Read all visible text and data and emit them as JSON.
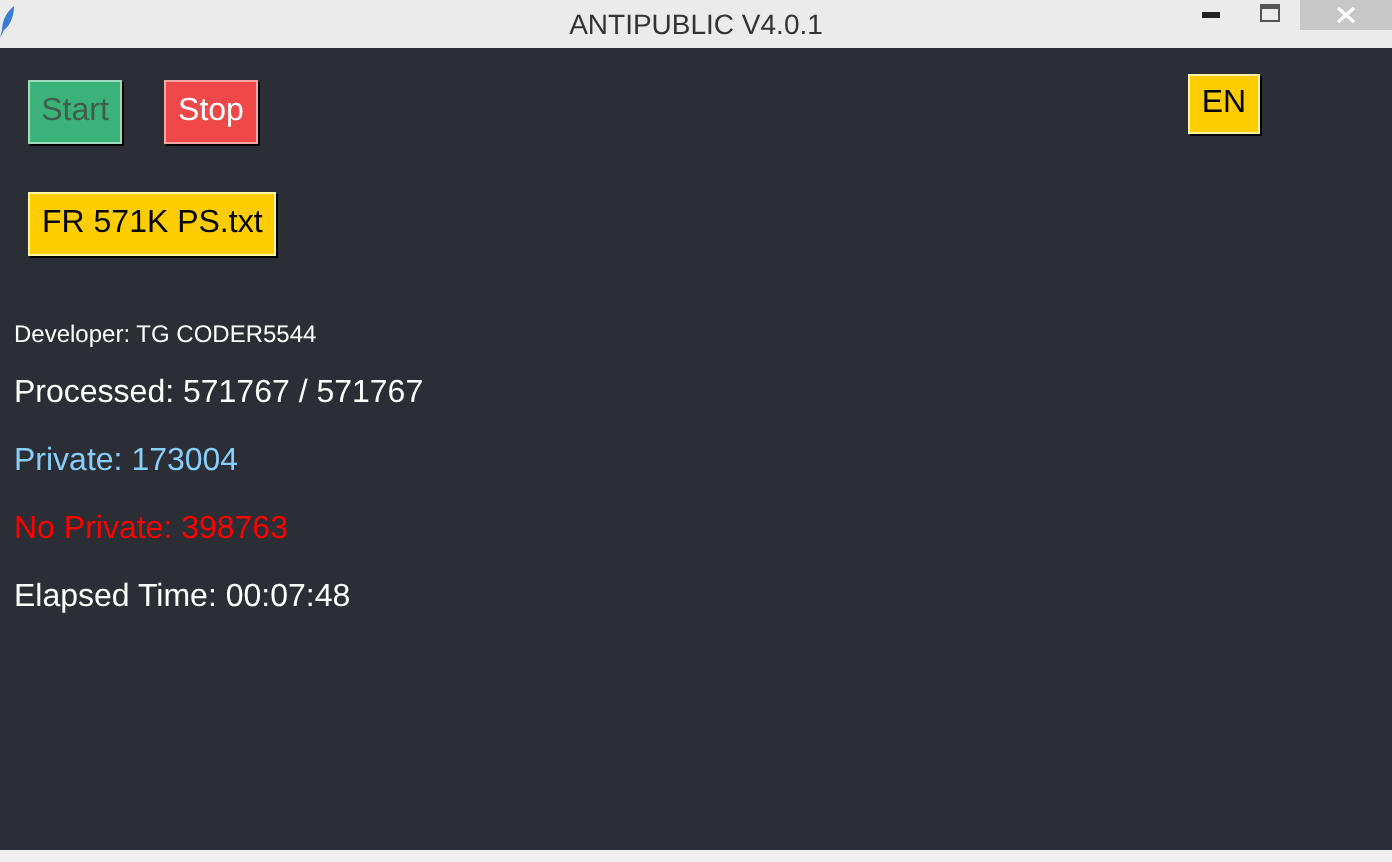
{
  "window": {
    "title": "ANTIPUBLIC V4.0.1"
  },
  "buttons": [
    {
      "label": "Start",
      "kind": "start",
      "disabled": true
    },
    {
      "label": "Stop",
      "kind": "stop",
      "disabled": false
    }
  ],
  "language_button": {
    "label": "EN"
  },
  "file_button": {
    "label": "FR 571K PS.txt"
  },
  "developer": "Developer: TG CODER5544",
  "stats": [
    {
      "text": "Processed: 571767 / 571767",
      "color": "#ffffff"
    },
    {
      "text": "Private: 173004",
      "color": "#87cefa"
    },
    {
      "text": "No Private: 398763",
      "color": "#ff0000"
    },
    {
      "text": "Elapsed Time: 00:07:48",
      "color": "#ffffff"
    }
  ]
}
